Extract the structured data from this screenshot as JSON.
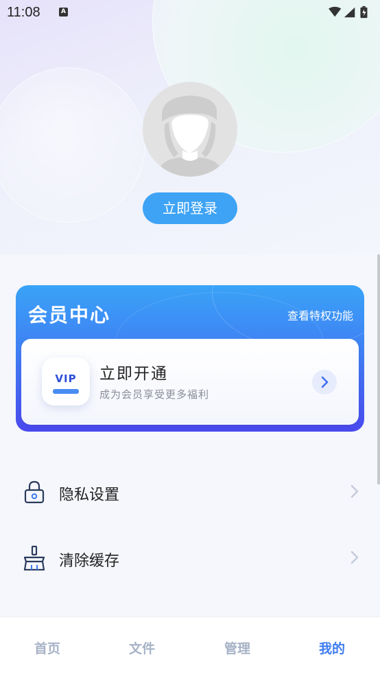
{
  "status_bar": {
    "time": "11:08",
    "notification_icon": "A"
  },
  "header": {
    "login_label": "立即登录"
  },
  "vip_center": {
    "title": "会员中心",
    "privilege_link": "查看特权功能",
    "badge_text": "VIP",
    "open_title": "立即开通",
    "open_subtitle": "成为会员享受更多福利"
  },
  "menu": [
    {
      "label": "隐私设置",
      "icon": "lock-icon"
    },
    {
      "label": "清除缓存",
      "icon": "broom-icon"
    }
  ],
  "tabs": [
    {
      "label": "首页",
      "active": false
    },
    {
      "label": "文件",
      "active": false
    },
    {
      "label": "管理",
      "active": false
    },
    {
      "label": "我的",
      "active": true
    }
  ],
  "colors": {
    "primary": "#3ea3f5",
    "accent": "#3e7cf0",
    "vip_gradient_end": "#4a49ee"
  }
}
